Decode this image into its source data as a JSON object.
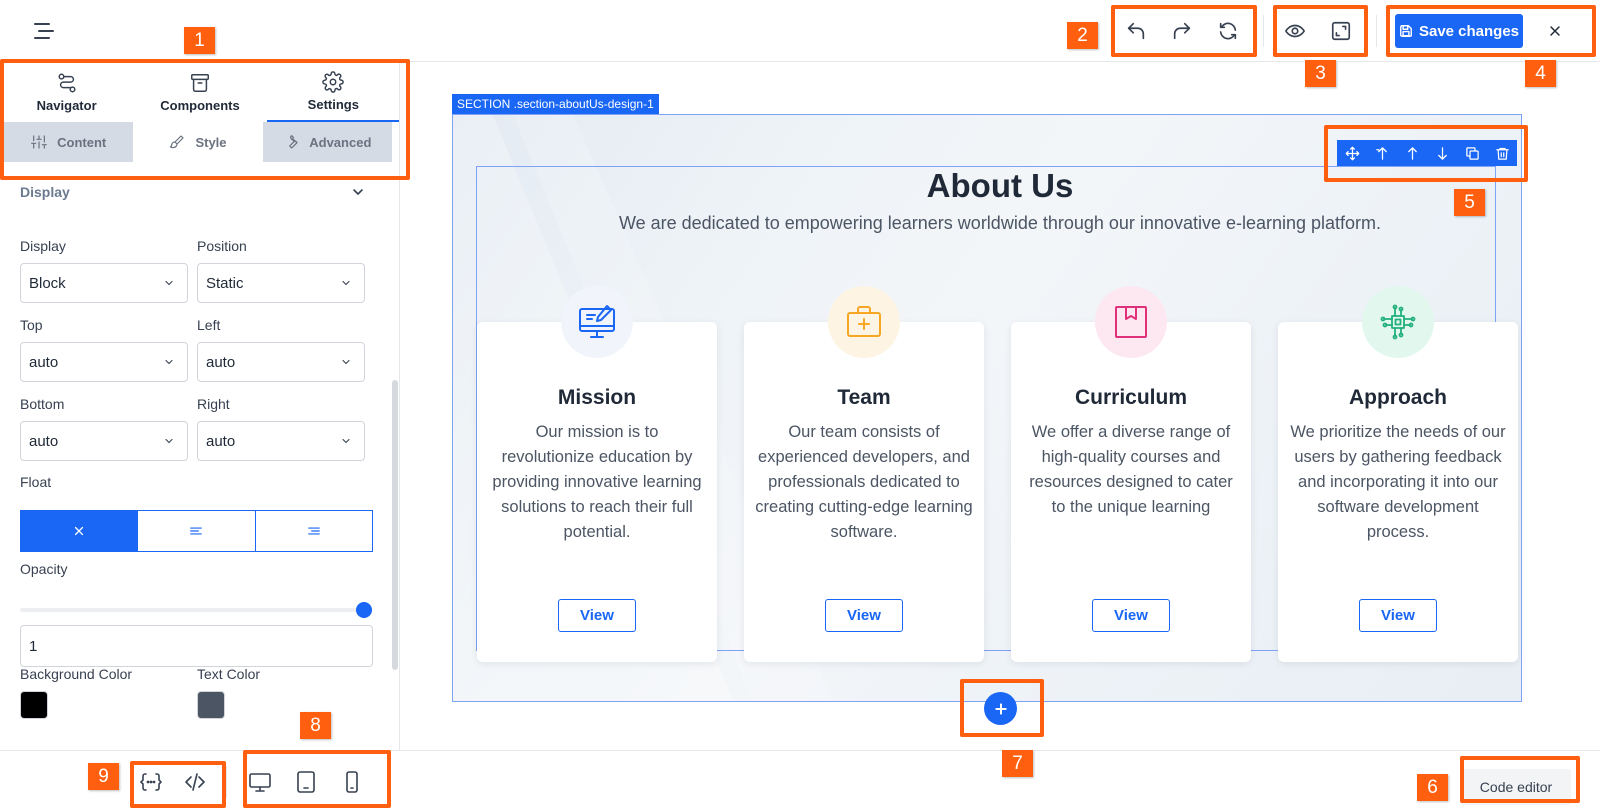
{
  "toolbar": {
    "save_label": "Save changes"
  },
  "left_panel": {
    "main_tabs": [
      {
        "label": "Navigator",
        "icon": "route-icon"
      },
      {
        "label": "Components",
        "icon": "archive-icon"
      },
      {
        "label": "Settings",
        "icon": "gear-icon"
      }
    ],
    "sub_tabs": [
      {
        "label": "Content",
        "icon": "sliders-icon"
      },
      {
        "label": "Style",
        "icon": "brush-icon"
      },
      {
        "label": "Advanced",
        "icon": "wrench-icon"
      }
    ],
    "section_title": "Display",
    "fields": {
      "display_label": "Display",
      "display_value": "Block",
      "position_label": "Position",
      "position_value": "Static",
      "top_label": "Top",
      "top_value": "auto",
      "left_label": "Left",
      "left_value": "auto",
      "bottom_label": "Bottom",
      "bottom_value": "auto",
      "right_label": "Right",
      "right_value": "auto",
      "float_label": "Float",
      "opacity_label": "Opacity",
      "opacity_value": "1",
      "bg_color_label": "Background Color",
      "text_color_label": "Text Color"
    },
    "opacity_level": 1,
    "bg_color": "#000000",
    "text_color": "#4b5563"
  },
  "bottom_bar": {
    "code_editor_label": "Code editor"
  },
  "canvas": {
    "section_tag": "SECTION .section-aboutUs-design-1",
    "title": "About Us",
    "subtitle": "We are dedicated to empowering learners worldwide through our innovative e-learning platform.",
    "cards": [
      {
        "title": "Mission",
        "text": "Our mission is to revolutionize education by providing innovative learning solutions to reach their full potential.",
        "button": "View",
        "icon": "monitor-paintbrush-icon",
        "accent": "#1a66f5"
      },
      {
        "title": "Team",
        "text": "Our team consists of experienced developers, and professionals dedicated to creating cutting-edge learning software.",
        "button": "View",
        "icon": "briefcase-medical-icon",
        "accent": "#f5a623"
      },
      {
        "title": "Curriculum",
        "text": "We offer a diverse range of high-quality courses and resources designed to cater to the unique learning",
        "button": "View",
        "icon": "package-icon",
        "accent": "#e0307a"
      },
      {
        "title": "Approach",
        "text": "We prioritize the needs of our users by gathering feedback and incorporating it into our software development process.",
        "button": "View",
        "icon": "circuit-chip-icon",
        "accent": "#22b07d"
      }
    ]
  },
  "annotations": [
    "1",
    "2",
    "3",
    "4",
    "5",
    "6",
    "7",
    "8",
    "9"
  ],
  "colors": {
    "accent": "#1a66f5",
    "annotation": "#ff5f0f"
  }
}
